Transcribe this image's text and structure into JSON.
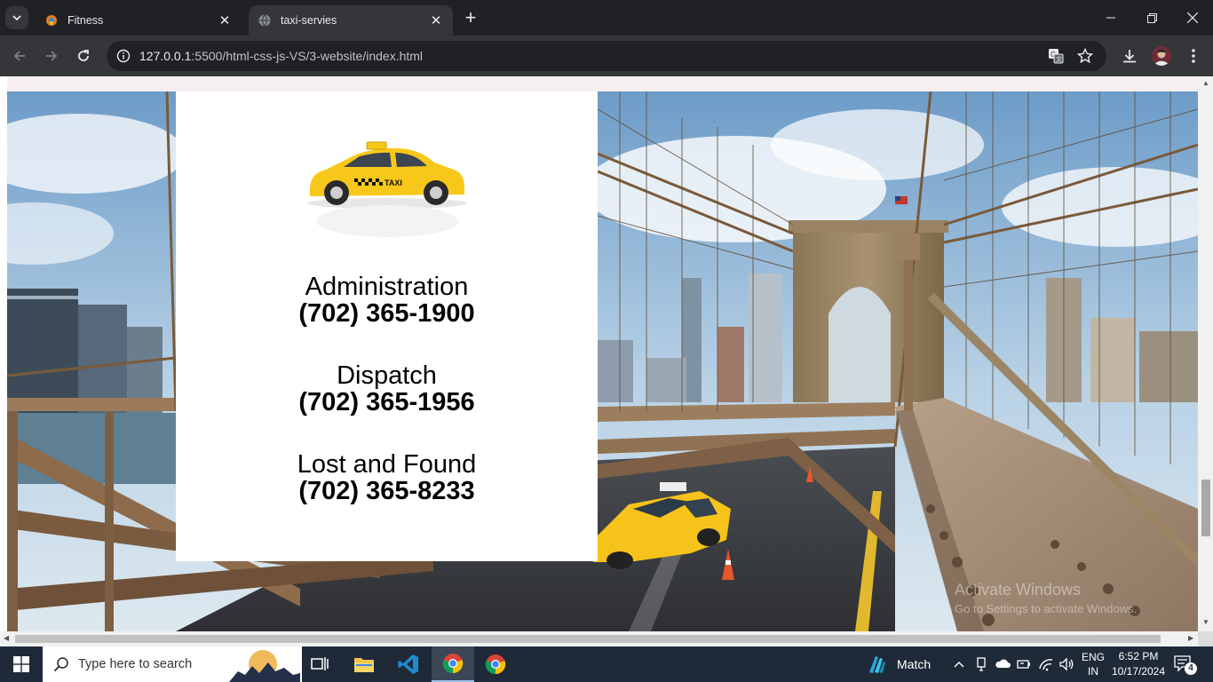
{
  "browser": {
    "tabs": [
      {
        "title": "Fitness",
        "active": false
      },
      {
        "title": "taxi-servies",
        "active": true
      }
    ],
    "url_host": "127.0.0.1",
    "url_rest": ":5500/html-css-js-VS/3-website/index.html"
  },
  "page": {
    "contacts": [
      {
        "label": "Administration",
        "phone": "(702) 365-1900"
      },
      {
        "label": "Dispatch",
        "phone": "(702) 365-1956"
      },
      {
        "label": "Lost and Found",
        "phone": "(702) 365-8233"
      }
    ],
    "taxi_sign": "TAXI",
    "watermark_title": "Activate Windows",
    "watermark_sub": "Go to Settings to activate Windows."
  },
  "taskbar": {
    "search_placeholder": "Type here to search",
    "weather_label": "Match",
    "lang_top": "ENG",
    "lang_bottom": "IN",
    "time": "6:52 PM",
    "date": "10/17/2024",
    "notification_count": "4"
  },
  "colors": {
    "accent_taxi": "#f7c81a",
    "tab_active": "#35363a",
    "taskbar": "#1f2a38"
  }
}
